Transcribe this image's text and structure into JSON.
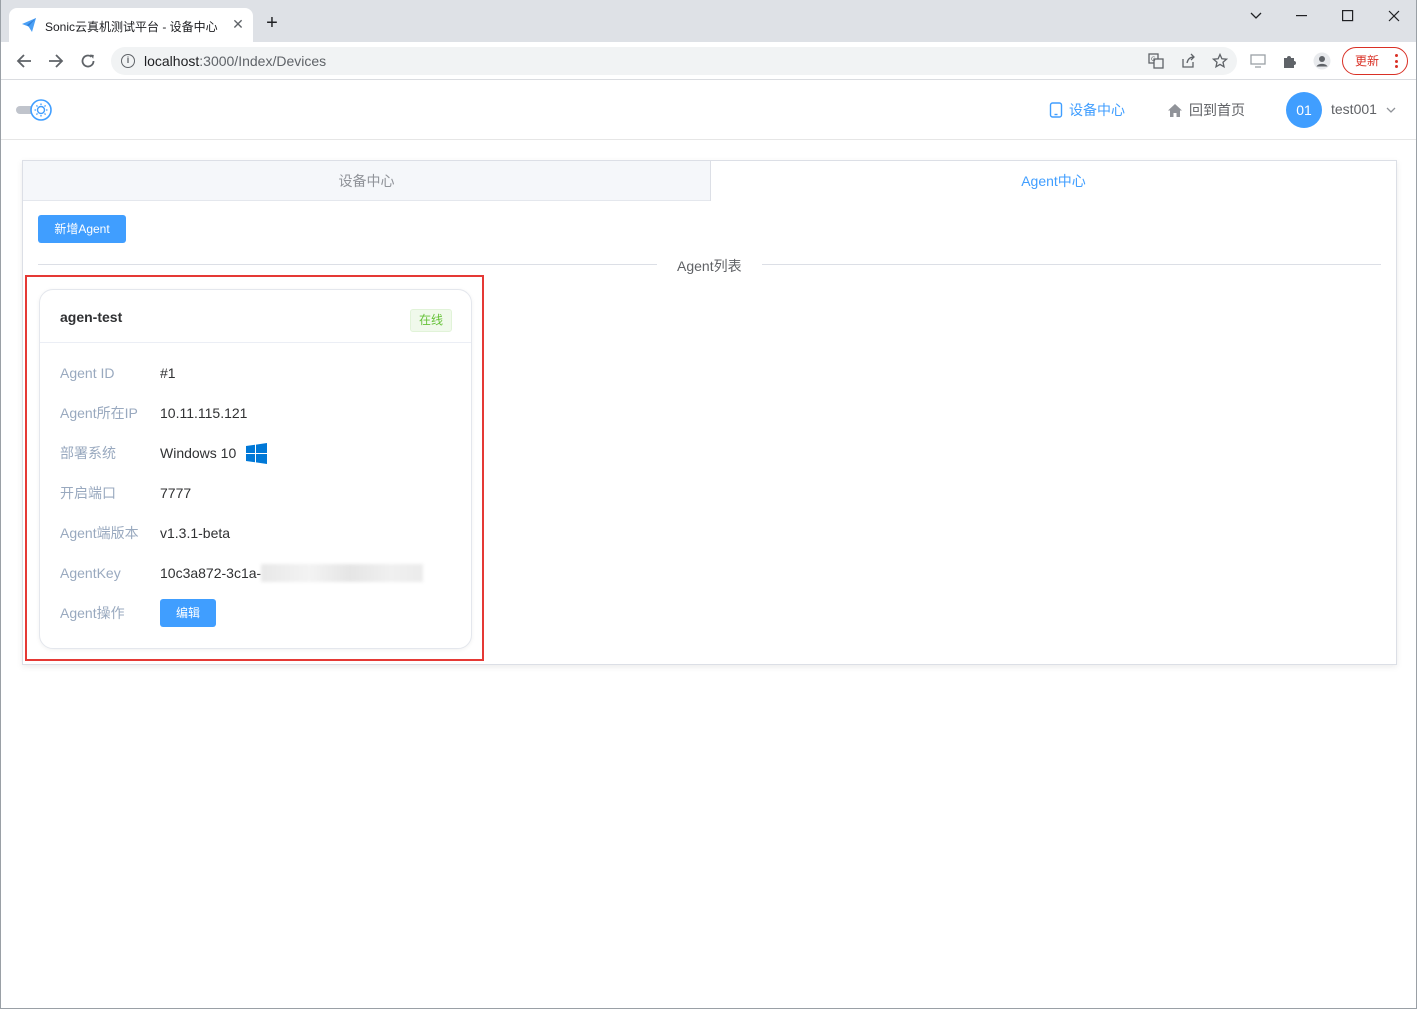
{
  "browser": {
    "tab_title": "Sonic云真机测试平台 - 设备中心",
    "url_host": "localhost",
    "url_rest": ":3000/Index/Devices",
    "update_label": "更新"
  },
  "header": {
    "devices_link": "设备中心",
    "home_link": "回到首页",
    "avatar_text": "01",
    "username": "test001"
  },
  "tabs": [
    {
      "label": "设备中心",
      "active": false
    },
    {
      "label": "Agent中心",
      "active": true
    }
  ],
  "toolbar": {
    "add_agent_label": "新增Agent"
  },
  "list": {
    "divider_title": "Agent列表"
  },
  "agent": {
    "name": "agen-test",
    "status": "在线",
    "rows": {
      "id_label": "Agent ID",
      "id_value": "#1",
      "ip_label": "Agent所在IP",
      "ip_value": "10.11.115.121",
      "os_label": "部署系统",
      "os_value": "Windows 10",
      "port_label": "开启端口",
      "port_value": "7777",
      "version_label": "Agent端版本",
      "version_value": "v1.3.1-beta",
      "key_label": "AgentKey",
      "key_value": "10c3a872-3c1a-",
      "action_label": "Agent操作",
      "edit_label": "编辑"
    }
  },
  "colors": {
    "primary": "#409eff",
    "success": "#67c23a",
    "highlight_border": "#e53935",
    "windows_blue": "#0078d7"
  }
}
